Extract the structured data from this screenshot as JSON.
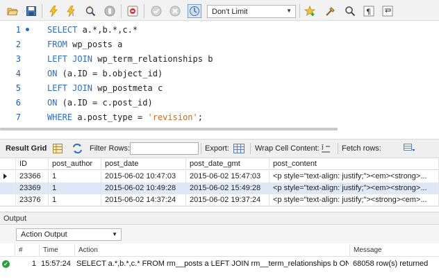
{
  "toolbar": {
    "limit_value": "Don't Limit",
    "icons": [
      "folder-open-icon",
      "save-icon",
      "execute-icon",
      "execute-current-icon",
      "explain-icon",
      "stop-icon",
      "toggle-stop-on-error-icon",
      "commit-icon",
      "rollback-icon",
      "autocommit-icon",
      "beautify-icon",
      "find-icon",
      "invisible-chars-icon",
      "wrap-icon",
      "snippet-star-icon"
    ]
  },
  "editor": {
    "line_numbers": [
      "1",
      "2",
      "3",
      "4",
      "5",
      "6",
      "7"
    ],
    "lines": [
      [
        {
          "t": "kw",
          "v": "SELECT"
        },
        {
          "t": "id",
          "v": " a.*,b.*,c.*"
        }
      ],
      [
        {
          "t": "kw",
          "v": "FROM"
        },
        {
          "t": "id",
          "v": " wp_posts a"
        }
      ],
      [
        {
          "t": "kw",
          "v": "LEFT JOIN"
        },
        {
          "t": "id",
          "v": " wp_term_relationships b"
        }
      ],
      [
        {
          "t": "kw",
          "v": "ON"
        },
        {
          "t": "id",
          "v": " (a.ID = b.object_id)"
        }
      ],
      [
        {
          "t": "kw",
          "v": "LEFT JOIN"
        },
        {
          "t": "id",
          "v": " wp_postmeta c"
        }
      ],
      [
        {
          "t": "kw",
          "v": "ON"
        },
        {
          "t": "id",
          "v": " (a.ID = c.post_id)"
        }
      ],
      [
        {
          "t": "kw",
          "v": "WHERE"
        },
        {
          "t": "id",
          "v": " a.post_type = "
        },
        {
          "t": "str",
          "v": "'revision'"
        },
        {
          "t": "id",
          "v": ";"
        }
      ]
    ]
  },
  "result_toolbar": {
    "tab_label": "Result Grid",
    "filter_label": "Filter Rows:",
    "filter_value": "",
    "export_label": "Export:",
    "wrap_label": "Wrap Cell Content:",
    "fetch_label": "Fetch rows:"
  },
  "grid": {
    "columns": [
      "ID",
      "post_author",
      "post_date",
      "post_date_gmt",
      "post_content"
    ],
    "rows": [
      [
        "23366",
        "1",
        "2015-06-02 10:47:03",
        "2015-06-02 15:47:03",
        "<p style=\"text-align: justify;\"><em><strong>..."
      ],
      [
        "23369",
        "1",
        "2015-06-02 10:49:28",
        "2015-06-02 15:49:28",
        "<p style=\"text-align: justify;\"><em><strong>..."
      ],
      [
        "23376",
        "1",
        "2015-06-02 14:37:24",
        "2015-06-02 19:37:24",
        "<p style=\"text-align: justify;\"><strong><em>..."
      ]
    ]
  },
  "output": {
    "title": "Output",
    "select_value": "Action Output",
    "columns": [
      "#",
      "Time",
      "Action",
      "Message"
    ],
    "rows": [
      {
        "status": "ok",
        "num": "1",
        "time": "15:57:24",
        "action": "SELECT a.*,b.*,c.* FROM rm__posts a LEFT JOIN rm__term_relationships b ON ...",
        "message": "68058 row(s) returned"
      }
    ]
  },
  "colors": {
    "keyword": "#2f6cc0",
    "string": "#c56b1f",
    "line_number": "#1c5fb0",
    "selected_row": "#dfe8f6",
    "status_ok": "#2aa13b"
  }
}
